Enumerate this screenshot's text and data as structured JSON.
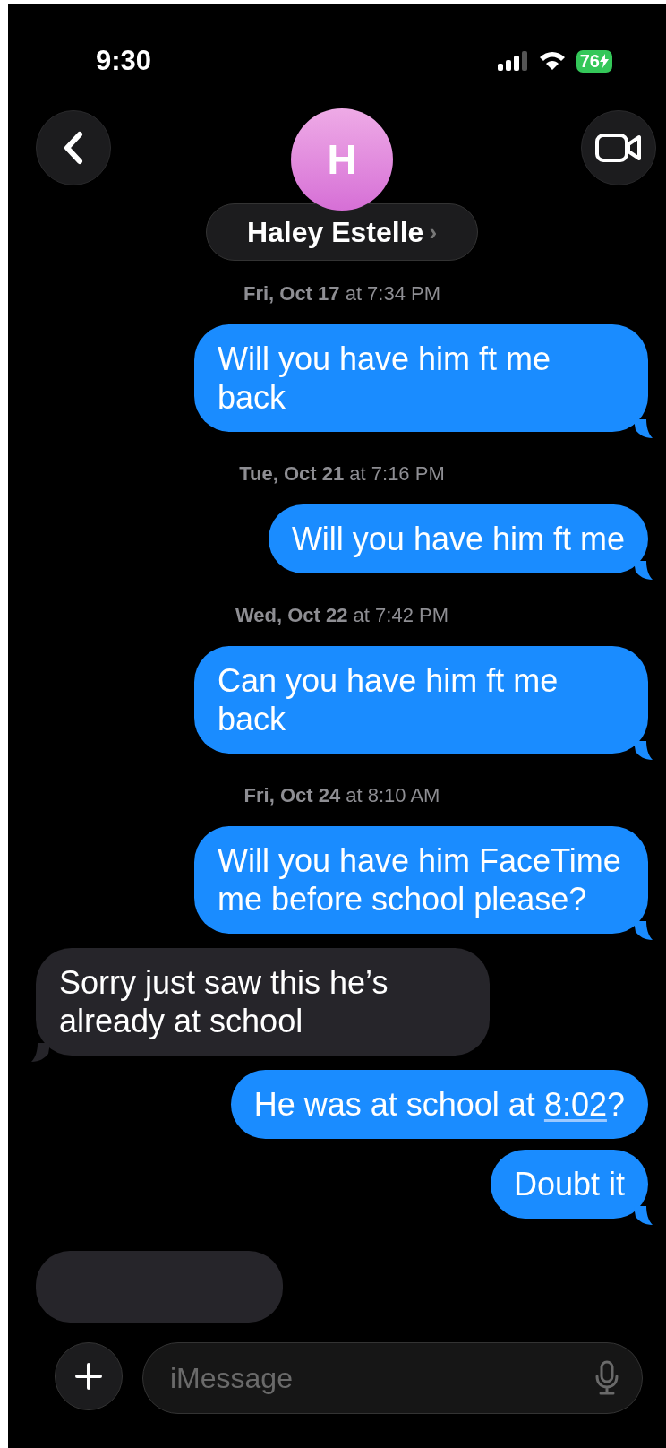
{
  "status_bar": {
    "time": "9:30",
    "battery": "76",
    "charging": true
  },
  "header": {
    "avatar_initial": "H",
    "contact_name": "Haley Estelle",
    "chevron": "›"
  },
  "messages": [
    {
      "kind": "timestamp",
      "text": "**Fri, Oct 17** at 7:34 PM"
    },
    {
      "kind": "message",
      "outgoing": true,
      "tail": true,
      "parts": [
        {
          "kind": "plain",
          "text": "Will you have him ft me back"
        }
      ]
    },
    {
      "kind": "timestamp",
      "text": "**Tue, Oct 21** at 7:16 PM"
    },
    {
      "kind": "message",
      "outgoing": true,
      "tail": true,
      "parts": [
        {
          "kind": "plain",
          "text": "Will you have him ft me"
        }
      ]
    },
    {
      "kind": "timestamp",
      "text": "**Wed, Oct 22** at 7:42 PM"
    },
    {
      "kind": "message",
      "outgoing": true,
      "tail": true,
      "parts": [
        {
          "kind": "plain",
          "text": "Can you have him ft me back"
        }
      ]
    },
    {
      "kind": "timestamp",
      "text": "**Fri, Oct 24** at 8:10 AM"
    },
    {
      "kind": "message",
      "outgoing": true,
      "tail": true,
      "parts": [
        {
          "kind": "plain",
          "text": "Will you have him FaceTime me before school please?"
        }
      ]
    },
    {
      "kind": "message",
      "outgoing": false,
      "tail": true,
      "parts": [
        {
          "kind": "plain",
          "text": "Sorry just saw this he’s already at school"
        }
      ]
    },
    {
      "kind": "message",
      "outgoing": true,
      "tail": false,
      "parts": [
        {
          "kind": "plain",
          "text": "He was at school at "
        },
        {
          "kind": "link",
          "text": "8:02"
        },
        {
          "kind": "plain",
          "text": "?"
        }
      ]
    },
    {
      "kind": "message",
      "outgoing": true,
      "tail": true,
      "parts": [
        {
          "kind": "plain",
          "text": "Doubt it"
        }
      ]
    },
    {
      "kind": "partial",
      "outgoing": false
    }
  ],
  "composer": {
    "placeholder": "iMessage"
  }
}
